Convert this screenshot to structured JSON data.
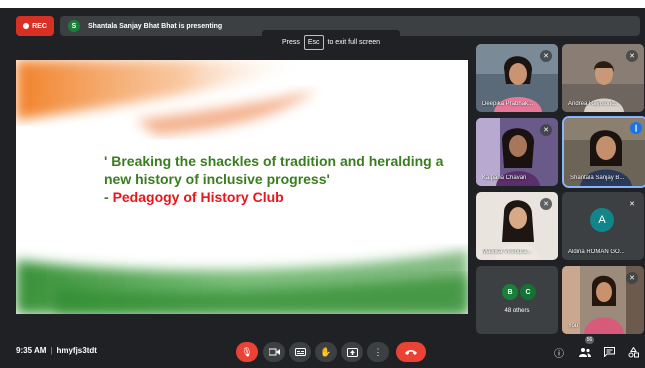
{
  "rec_badge": {
    "label": "REC",
    "color": "#d93025"
  },
  "presenter_bar": {
    "initial": "S",
    "text": "Shantala Sanjay Bhat Bhat is presenting"
  },
  "fullscreen_hint": {
    "prefix": "Press",
    "key": "Esc",
    "suffix": "to exit full screen"
  },
  "slide": {
    "quote": "' Breaking the shackles of tradition and heralding a new history of inclusive progress'",
    "club_dash": "- ",
    "club": "Pedagogy of History Club",
    "colors": {
      "saffron": "#f07b1f",
      "green": "#2e8b2e",
      "quote_text": "#3a7d1f",
      "club_text": "#e8161a"
    }
  },
  "participants": [
    {
      "name": "Deepika Prabhak...",
      "muted": true,
      "icon": "mic-off-icon"
    },
    {
      "name": "Andrea Raymond...",
      "muted": true,
      "icon": "mic-off-icon"
    },
    {
      "name": "Kalpana Chavan",
      "muted": true,
      "icon": "mic-off-icon"
    },
    {
      "name": "Shantala Sanjay B...",
      "speaking": true,
      "icon": "speaking-icon"
    },
    {
      "name": "Malvika Virendra...",
      "muted": true,
      "icon": "mic-off-icon"
    },
    {
      "name": "Aldina ROMAN GO...",
      "muted": true,
      "avatar_letter": "A",
      "avatar_color": "#12858a",
      "icon": "mic-off-icon"
    },
    {
      "name": "You",
      "muted": true,
      "icon": "mic-off-icon"
    }
  ],
  "others_tile": {
    "avatars": [
      "B",
      "C"
    ],
    "label": "48 others"
  },
  "bottom_bar": {
    "time": "9:35 AM",
    "meeting_code": "hmyfjs3tdt",
    "controls": [
      "mic-off-icon",
      "camera-icon",
      "captions-icon",
      "raise-hand-icon",
      "present-icon",
      "more-options-icon",
      "hang-up-icon"
    ],
    "right_controls": [
      "info-icon",
      "people-icon",
      "chat-icon",
      "activities-icon"
    ],
    "people_count": "56"
  }
}
